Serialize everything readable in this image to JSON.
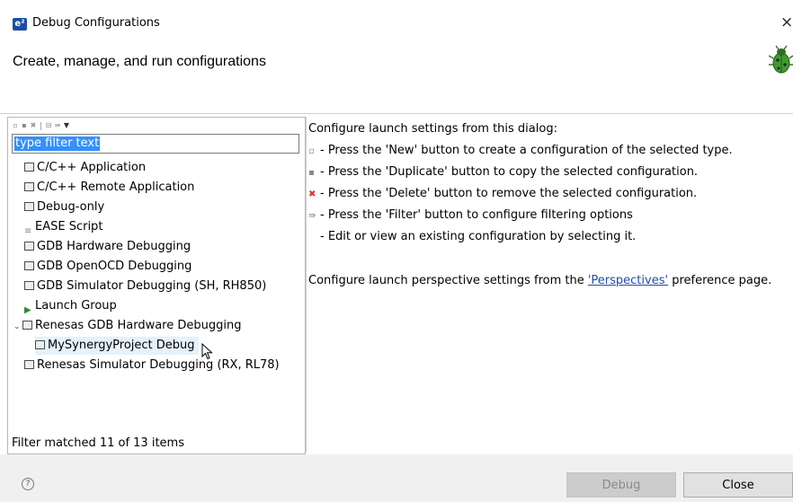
{
  "window": {
    "icon_text": "e²",
    "title": "Debug Configurations",
    "close_glyph": "×"
  },
  "header": {
    "title": "Create, manage, and run configurations",
    "icon": "bug-icon"
  },
  "left": {
    "toolbar_icons": [
      "new-icon",
      "duplicate-icon",
      "delete-icon",
      "collapse-icon",
      "filter-icon",
      "menu-dropdown-icon"
    ],
    "filter": {
      "value": "type filter text"
    },
    "tree": [
      {
        "label": "C/C++ Application",
        "icon": "config-icon",
        "level": 0
      },
      {
        "label": "C/C++ Remote Application",
        "icon": "config-icon",
        "level": 0
      },
      {
        "label": "Debug-only",
        "icon": "config-icon",
        "level": 0
      },
      {
        "label": "EASE Script",
        "icon": "script-icon",
        "level": 0
      },
      {
        "label": "GDB Hardware Debugging",
        "icon": "config-icon",
        "level": 0
      },
      {
        "label": "GDB OpenOCD Debugging",
        "icon": "config-icon",
        "level": 0
      },
      {
        "label": "GDB Simulator Debugging (SH, RH850)",
        "icon": "config-icon",
        "level": 0
      },
      {
        "label": "Launch Group",
        "icon": "launch-icon",
        "level": 0
      },
      {
        "label": "Renesas GDB Hardware Debugging",
        "icon": "config-icon",
        "level": 0,
        "expanded": true
      },
      {
        "label": "MySynergyProject Debug",
        "icon": "config-icon",
        "level": 1,
        "hovered": true
      },
      {
        "label": "Renesas Simulator Debugging (RX, RL78)",
        "icon": "config-icon",
        "level": 0
      }
    ],
    "status": "Filter matched 11 of 13 items"
  },
  "right": {
    "intro": "Configure launch settings from this dialog:",
    "lines": [
      {
        "icon": "new-icon",
        "text": "- Press the 'New' button to create a configuration of the selected type."
      },
      {
        "icon": "duplicate-icon",
        "text": "- Press the 'Duplicate' button to copy the selected configuration."
      },
      {
        "icon": "delete-icon",
        "text": "- Press the 'Delete' button to remove the selected configuration."
      },
      {
        "icon": "filter-icon",
        "text": "- Press the 'Filter' button to configure filtering options"
      },
      {
        "icon": "",
        "text": "- Edit or view an existing configuration by selecting it."
      }
    ],
    "perspective_prefix": "Configure launch perspective settings from the ",
    "perspective_link": "'Perspectives'",
    "perspective_suffix": " preference page."
  },
  "footer": {
    "help_glyph": "?",
    "debug_label": "Debug",
    "close_label": "Close"
  },
  "colors": {
    "selection": "#3390ff",
    "link": "#1f4ea0",
    "bottom_bar": "#f0f0f0"
  }
}
